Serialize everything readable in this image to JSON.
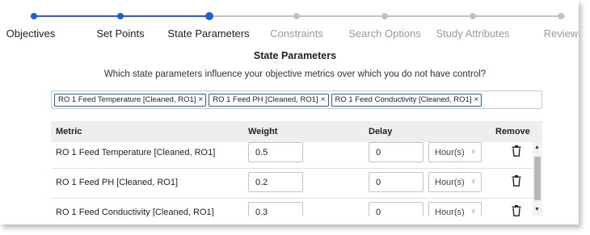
{
  "stepper": {
    "steps": [
      {
        "label": "Objectives",
        "state": "done"
      },
      {
        "label": "Set Points",
        "state": "done"
      },
      {
        "label": "State Parameters",
        "state": "active"
      },
      {
        "label": "Constraints",
        "state": "todo"
      },
      {
        "label": "Search Options",
        "state": "todo"
      },
      {
        "label": "Study Attributes",
        "state": "todo"
      },
      {
        "label": "Review",
        "state": "todo"
      }
    ],
    "accent_color": "#1f5fcf",
    "inactive_color": "#c2c2c2"
  },
  "section": {
    "title": "State Parameters",
    "question": "Which state parameters influence your objective metrics over which you do not have control?"
  },
  "selected_tags": [
    "RO 1 Feed Temperature [Cleaned, RO1]",
    "RO 1 Feed PH [Cleaned, RO1]",
    "RO 1 Feed Conductivity [Cleaned, RO1]"
  ],
  "tag_remove_glyph": "×",
  "table": {
    "headers": {
      "metric": "Metric",
      "weight": "Weight",
      "delay": "Delay",
      "remove": "Remove"
    },
    "rows": [
      {
        "metric": "RO 1 Feed Temperature [Cleaned, RO1]",
        "weight": "0.5",
        "delay": "0",
        "unit": "Hour(s)"
      },
      {
        "metric": "RO 1 Feed PH [Cleaned, RO1]",
        "weight": "0.2",
        "delay": "0",
        "unit": "Hour(s)"
      },
      {
        "metric": "RO 1 Feed Conductivity [Cleaned, RO1]",
        "weight": "0.3",
        "delay": "0",
        "unit": "Hour(s)"
      }
    ]
  },
  "icons": {
    "remove": "trash-icon",
    "unit_dropdown": "chevron-down-icon"
  }
}
